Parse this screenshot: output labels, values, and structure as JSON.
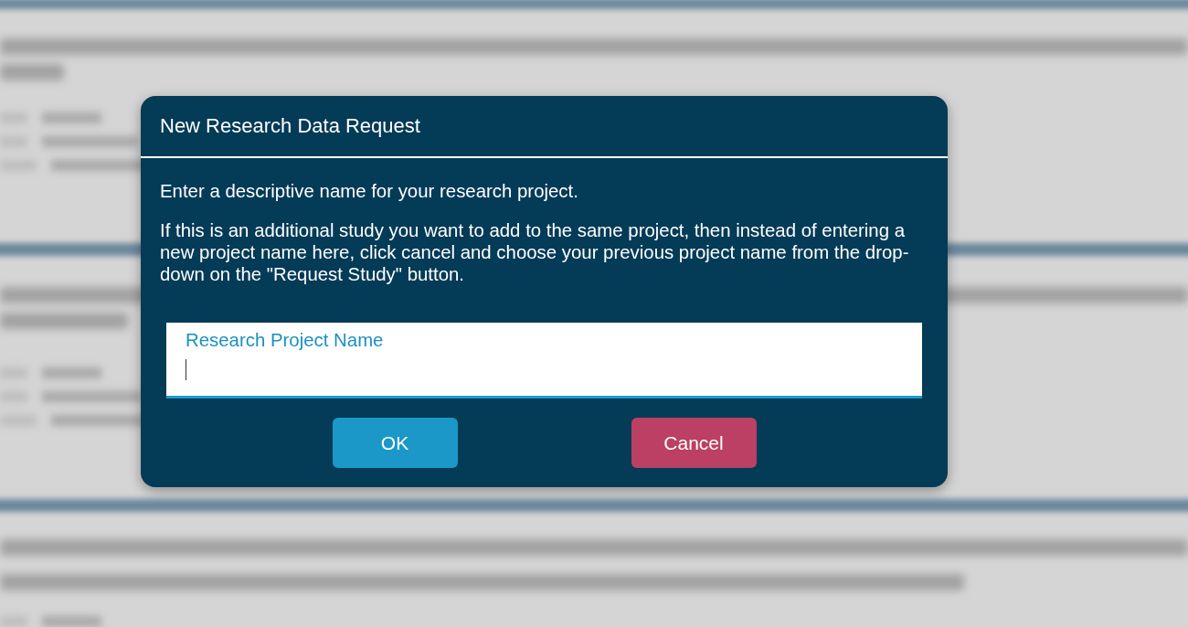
{
  "dialog": {
    "title": "New Research Data Request",
    "paragraphs": [
      "Enter a descriptive name for your research project.",
      "If this is an additional study you want to add to the same project, then instead of entering a new project name here, click cancel and choose your previous project name from the drop-down on the \"Request Study\" button."
    ],
    "field": {
      "label": "Research Project Name",
      "focused": true
    },
    "buttons": [
      {
        "label": "OK",
        "kind": "primary"
      },
      {
        "label": "Cancel",
        "kind": "danger"
      }
    ]
  }
}
